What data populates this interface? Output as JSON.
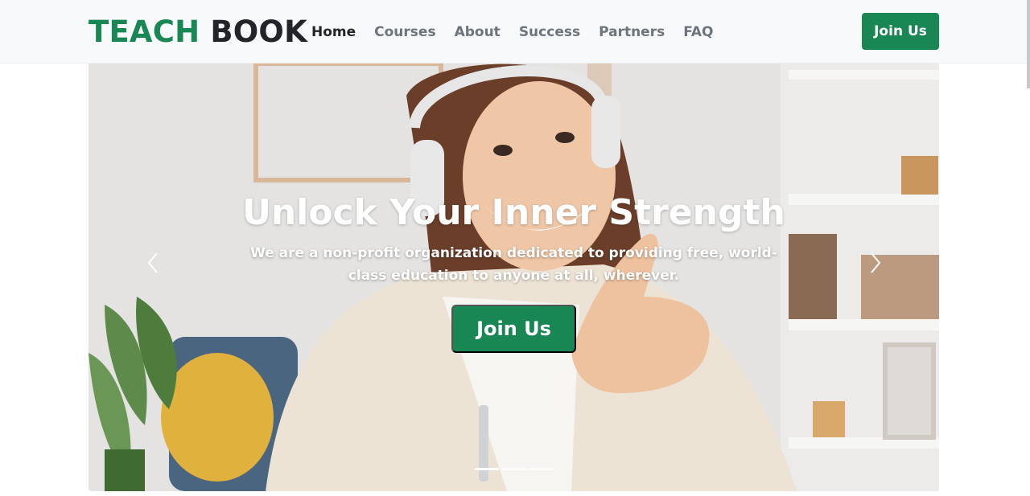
{
  "brand": {
    "part1": "TEACH",
    "part2": "BOOK"
  },
  "nav": {
    "links": [
      "Home",
      "Courses",
      "About",
      "Success",
      "Partners",
      "FAQ"
    ],
    "active": "Home",
    "join_label": "Join Us"
  },
  "hero": {
    "title": "Unlock Your Inner Strength",
    "subtitle": "We are a non-profit organization dedicated to providing free, world-class education to anyone at all, wherever.",
    "cta_label": "Join Us",
    "slide_count": 3,
    "active_slide": 1
  },
  "colors": {
    "brand_green": "#198754",
    "nav_bg": "#f8f9fa",
    "text_dark": "#212529",
    "text_muted": "#6c757d"
  },
  "icons": {
    "prev": "chevron-left-icon",
    "next": "chevron-right-icon"
  }
}
